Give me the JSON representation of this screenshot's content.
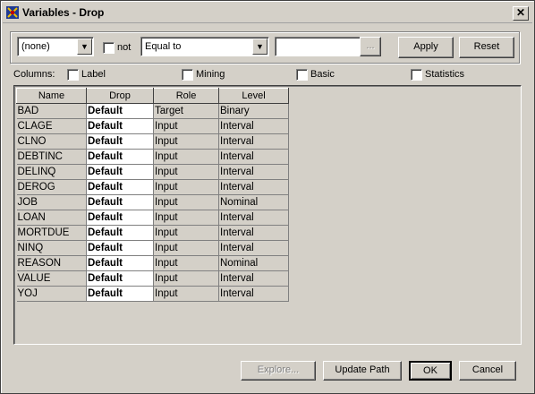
{
  "window": {
    "title": "Variables - Drop",
    "close_label": "✕"
  },
  "filter": {
    "field_value": "(none)",
    "not_label": "not",
    "operator_value": "Equal to",
    "value_text": "",
    "browse_label": "...",
    "apply_label": "Apply",
    "reset_label": "Reset"
  },
  "columns": {
    "label": "Columns:",
    "options": [
      {
        "label": "Label",
        "checked": false
      },
      {
        "label": "Mining",
        "checked": false
      },
      {
        "label": "Basic",
        "checked": false
      },
      {
        "label": "Statistics",
        "checked": false
      }
    ]
  },
  "table": {
    "headers": [
      "Name",
      "Drop",
      "Role",
      "Level"
    ],
    "rows": [
      [
        "BAD",
        "Default",
        "Target",
        "Binary"
      ],
      [
        "CLAGE",
        "Default",
        "Input",
        "Interval"
      ],
      [
        "CLNO",
        "Default",
        "Input",
        "Interval"
      ],
      [
        "DEBTINC",
        "Default",
        "Input",
        "Interval"
      ],
      [
        "DELINQ",
        "Default",
        "Input",
        "Interval"
      ],
      [
        "DEROG",
        "Default",
        "Input",
        "Interval"
      ],
      [
        "JOB",
        "Default",
        "Input",
        "Nominal"
      ],
      [
        "LOAN",
        "Default",
        "Input",
        "Interval"
      ],
      [
        "MORTDUE",
        "Default",
        "Input",
        "Interval"
      ],
      [
        "NINQ",
        "Default",
        "Input",
        "Interval"
      ],
      [
        "REASON",
        "Default",
        "Input",
        "Nominal"
      ],
      [
        "VALUE",
        "Default",
        "Input",
        "Interval"
      ],
      [
        "YOJ",
        "Default",
        "Input",
        "Interval"
      ]
    ]
  },
  "buttons": {
    "explore_label": "Explore...",
    "update_path_label": "Update Path",
    "ok_label": "OK",
    "cancel_label": "Cancel"
  },
  "icons": {
    "app": "sas-app-icon",
    "dropdown": "chevron-down-icon",
    "close": "close-icon"
  }
}
